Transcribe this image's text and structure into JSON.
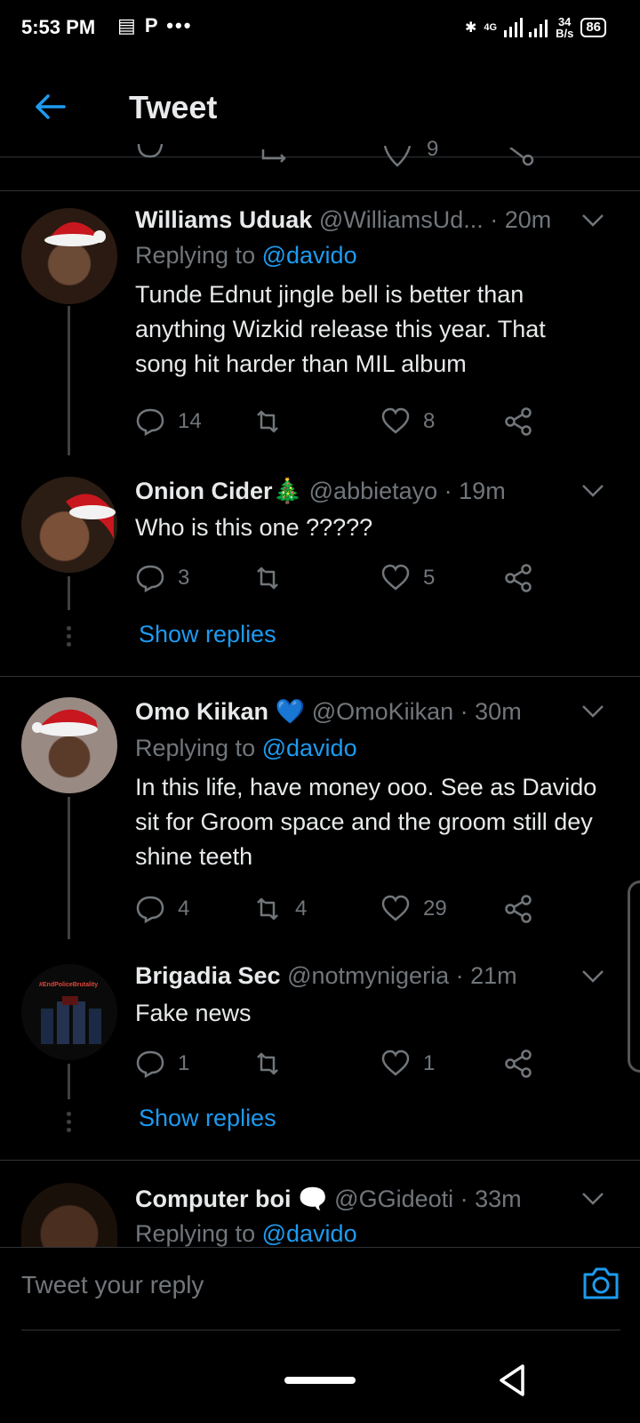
{
  "status_bar": {
    "time": "5:53 PM",
    "left_icons": "▤ P •••",
    "network": "4G",
    "speed_top": "34",
    "speed_bottom": "B/s",
    "battery": "86"
  },
  "header": {
    "title": "Tweet"
  },
  "tweets": [
    {
      "name": "Williams Uduak",
      "handle": "@WilliamsUd...",
      "time": "· 20m",
      "reply_label": "Replying to",
      "reply_handle": "@davido",
      "text": "Tunde Ednut jingle bell is better than anything Wizkid release this year. That song hit harder than MIL album",
      "replies": "14",
      "retweets": "",
      "likes": "8"
    },
    {
      "name": "Onion Cider",
      "emoji": "🎄",
      "handle": "@abbietayo",
      "time": "· 19m",
      "text": "Who is this one ?????",
      "replies": "3",
      "retweets": "",
      "likes": "5",
      "show_replies": "Show replies"
    },
    {
      "name": "Omo Kiikan",
      "emoji": "💙",
      "handle": "@OmoKiikan",
      "time": "· 30m",
      "reply_label": "Replying to",
      "reply_handle": "@davido",
      "text": "In this life, have money ooo. See as Davido sit for Groom space and the groom still dey shine teeth",
      "replies": "4",
      "retweets": "4",
      "likes": "29"
    },
    {
      "name": "Brigadia Sec",
      "handle": "@notmynigeria",
      "time": "· 21m",
      "text": "Fake news",
      "replies": "1",
      "retweets": "",
      "likes": "1",
      "show_replies": "Show replies",
      "avatar_text": "#EndPoliceBrutality"
    },
    {
      "name": "Computer boi",
      "emoji": "🗨️",
      "handle": "@GGideoti",
      "time": "· 33m",
      "reply_label": "Replying to",
      "reply_handle": "@davido"
    }
  ],
  "partial_row_likes": "9",
  "reply_bar": {
    "placeholder": "Tweet your reply"
  },
  "colors": {
    "accent": "#1d9bf0",
    "muted": "#71767b",
    "text": "#e7e9ea",
    "divider": "#2f3336"
  }
}
